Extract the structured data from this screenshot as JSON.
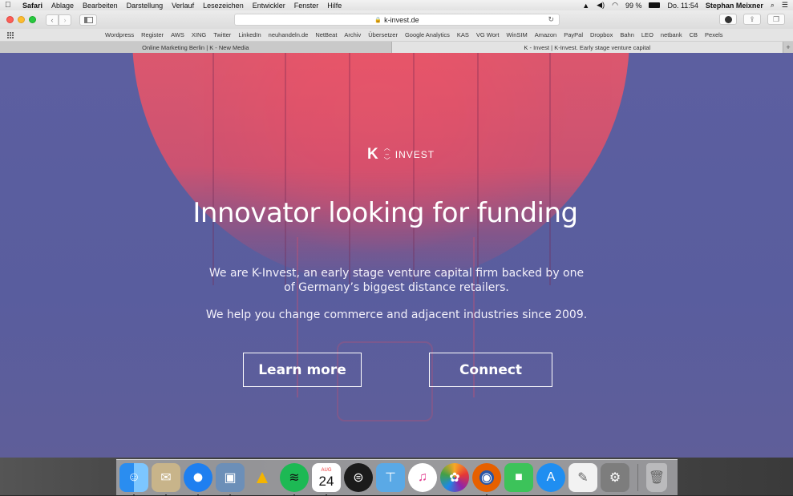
{
  "menubar": {
    "apple": "",
    "items": [
      "Safari",
      "Ablage",
      "Bearbeiten",
      "Darstellung",
      "Verlauf",
      "Lesezeichen",
      "Entwickler",
      "Fenster",
      "Hilfe"
    ],
    "battery": "99 %",
    "clock": "Do. 11:54",
    "user": "Stephan Meixner"
  },
  "toolbar": {
    "url": "k-invest.de",
    "back": "‹",
    "forward": "›"
  },
  "favorites": [
    "Wordpress",
    "Register",
    "AWS",
    "XING",
    "Twitter",
    "LinkedIn",
    "neuhandeln.de",
    "NetBeat",
    "Archiv",
    "Übersetzer",
    "Google Analytics",
    "KAS",
    "VG Wort",
    "WinSIM",
    "Amazon",
    "PayPal",
    "Dropbox",
    "Bahn",
    "LEO",
    "netbank",
    "CB",
    "Pexels"
  ],
  "tabs": [
    {
      "label": "Online Marketing Berlin | K - New Media"
    },
    {
      "label": "K - Invest | K-Invest. Early stage venture capital"
    }
  ],
  "hero": {
    "logo_k": "K",
    "logo_text": "INVEST",
    "headline": "Innovator looking for funding",
    "p1_line1": "We are K-Invest, an early stage venture capital firm backed by one",
    "p1_line2": "of Germany’s biggest distance retailers.",
    "p2": "We help you change commerce and adjacent industries since 2009.",
    "btn_learn": "Learn more",
    "btn_connect": "Connect"
  },
  "dock": {
    "calendar_month": "AUG",
    "calendar_day": "24",
    "icons": [
      "finder-icon",
      "mail-stamp-icon",
      "safari-icon",
      "preview-icon",
      "google-drive-icon",
      "spotify-icon",
      "calendar-icon",
      "app-e-icon",
      "keynote-icon",
      "itunes-icon",
      "photos-icon",
      "firefox-icon",
      "facetime-icon",
      "app-store-icon",
      "textedit-icon",
      "system-preferences-icon",
      "trash-icon"
    ]
  },
  "colors": {
    "hero_bg": "#5c5fa0",
    "balloon": "#ef5868"
  }
}
